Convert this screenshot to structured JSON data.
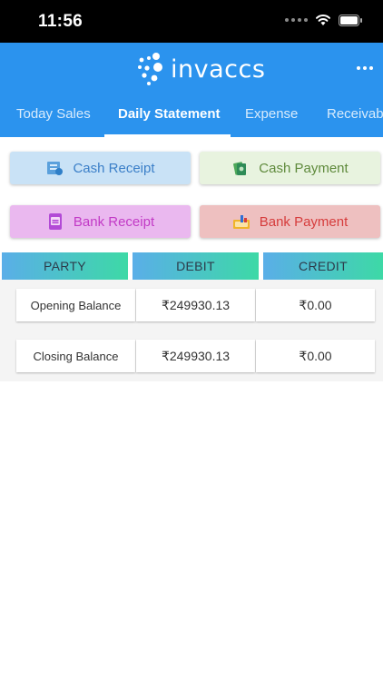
{
  "status_bar": {
    "time": "11:56"
  },
  "header": {
    "brand": "invaccs",
    "tabs": [
      {
        "label": "Today Sales",
        "active": false
      },
      {
        "label": "Daily Statement",
        "active": true
      },
      {
        "label": "Expense",
        "active": false
      },
      {
        "label": "Receivab",
        "active": false
      }
    ]
  },
  "actions": {
    "cash_receipt": "Cash Receipt",
    "cash_payment": "Cash Payment",
    "bank_receipt": "Bank Receipt",
    "bank_payment": "Bank Payment"
  },
  "table": {
    "columns": [
      "PARTY",
      "DEBIT",
      "CREDIT"
    ],
    "rows": [
      {
        "party": "Opening Balance",
        "debit": "₹249930.13",
        "credit": "₹0.00"
      },
      {
        "party": "Closing Balance",
        "debit": "₹249930.13",
        "credit": "₹0.00"
      }
    ]
  },
  "colors": {
    "header_blue": "#2b93ee",
    "cash_receipt_bg": "#c9e2f6",
    "cash_payment_bg": "#e8f3df",
    "bank_receipt_bg": "#eab8ef",
    "bank_payment_bg": "#eec0c0",
    "table_head_gradient_start": "#5aaee8",
    "table_head_gradient_end": "#3dd9a6"
  }
}
